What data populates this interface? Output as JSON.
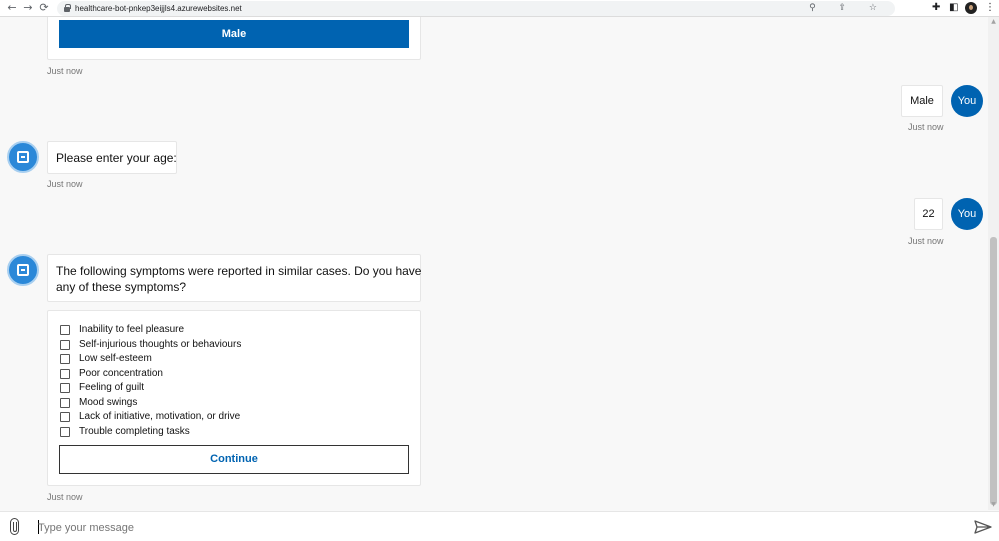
{
  "browser": {
    "url": "healthcare-bot-pnkep3eijjls4.azurewebsites.net",
    "back_icon": "←",
    "forward_icon": "→",
    "reload_icon": "⟳",
    "url_icons": "⚲ ⇪ ☆",
    "extension_icon": "✚",
    "sidepanel_icon": "◧",
    "menu_icon": "⋮"
  },
  "chat": {
    "messages": [
      {
        "type": "bot-card",
        "button_label": "Male",
        "timestamp": "Just now"
      },
      {
        "type": "user",
        "text": "Male",
        "avatar": "You",
        "timestamp": "Just now"
      },
      {
        "type": "bot",
        "text": "Please enter your age:",
        "timestamp": "Just now"
      },
      {
        "type": "user",
        "text": "22",
        "avatar": "You",
        "timestamp": "Just now"
      },
      {
        "type": "bot",
        "text_line1": "The following symptoms were reported in similar cases. Do you have",
        "text_line2": "any of these symptoms?"
      },
      {
        "type": "bot-card",
        "options": [
          "Inability to feel pleasure",
          "Self-injurious thoughts or behaviours",
          "Low self-esteem",
          "Poor concentration",
          "Feeling of guilt",
          "Mood swings",
          "Lack of initiative, motivation, or drive",
          "Trouble completing tasks"
        ],
        "button_label": "Continue",
        "timestamp": "Just now"
      }
    ]
  },
  "composer": {
    "placeholder": "Type your message",
    "value": ""
  },
  "colors": {
    "accent": "#0063b1",
    "bot_avatar": "#2b88d8",
    "background": "#f8f8f8"
  }
}
